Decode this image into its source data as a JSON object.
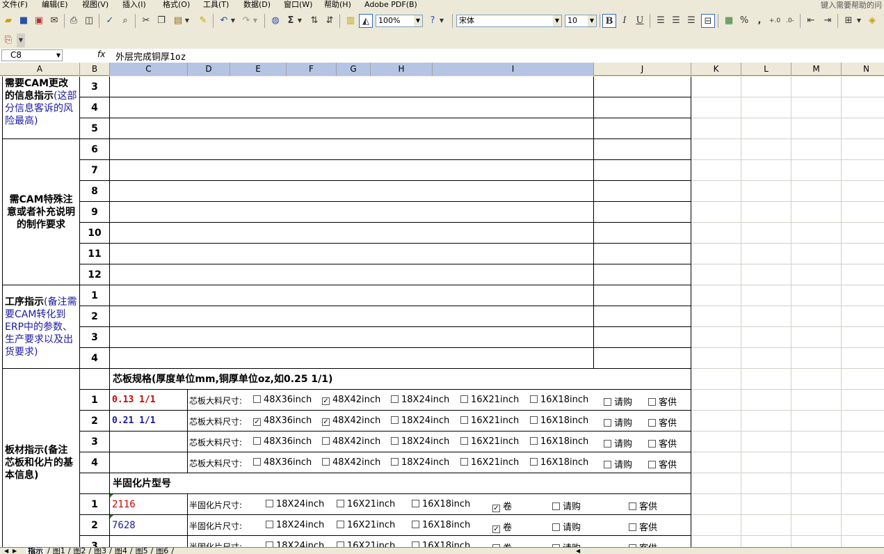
{
  "menu": [
    "文件(F)",
    "编辑(E)",
    "视图(V)",
    "插入(I)",
    "格式(O)",
    "工具(T)",
    "数据(D)",
    "窗口(W)",
    "帮助(H)",
    "Adobe PDF(B)"
  ],
  "help_search": "键入需要帮助的问",
  "toolbar": {
    "zoom": "100%",
    "font_name": "宋体",
    "font_size": "10",
    "sum_symbol": "Σ",
    "bold": "B",
    "italic": "I",
    "underline": "U",
    "percent": "%",
    "comma": ","
  },
  "formula_bar": {
    "name_box": "C8",
    "fx": "fx",
    "formula": "外层完成铜厚1oz"
  },
  "columns": [
    "A",
    "B",
    "C",
    "D",
    "E",
    "F",
    "G",
    "H",
    "I",
    "J",
    "K",
    "L",
    "M",
    "N"
  ],
  "sections": {
    "cam_change": {
      "title": "需要CAM更改的信息指示",
      "note": "(这部分信息客诉的风险最高)",
      "rows": [
        "3",
        "4",
        "5"
      ]
    },
    "cam_special": {
      "title": "需CAM特殊注意或者补充说明的制作要求",
      "rows": [
        "6",
        "7",
        "8",
        "9",
        "10",
        "11",
        "12"
      ]
    },
    "process": {
      "title": "工序指示",
      "note": "(备注需要CAM转化到ERP中的参数、生产要求以及出货要求)",
      "rows": [
        "1",
        "2",
        "3",
        "4"
      ]
    },
    "board": {
      "title": "板材指示",
      "note": "(备注芯板和化片的基本信息)",
      "core_header": "芯板规格(厚度单位mm,铜厚单位oz,如0.25 1/1)",
      "core_label": "芯板大料尺寸:",
      "core_options": [
        "48X36inch",
        "48X42inch",
        "18X24inch",
        "16X21inch",
        "16X18inch",
        "请购",
        "客供"
      ],
      "core_rows": [
        {
          "no": "1",
          "spec": "0.13 1/1",
          "checks": [
            false,
            true,
            false,
            false,
            false,
            false,
            false
          ]
        },
        {
          "no": "2",
          "spec": "0.21 1/1",
          "checks": [
            true,
            true,
            false,
            false,
            false,
            false,
            false
          ]
        },
        {
          "no": "3",
          "spec": "",
          "checks": [
            false,
            false,
            false,
            false,
            false,
            false,
            false
          ]
        },
        {
          "no": "4",
          "spec": "",
          "checks": [
            false,
            false,
            false,
            false,
            false,
            false,
            false
          ]
        }
      ],
      "pp_header": "半固化片型号",
      "pp_label": "半固化片尺寸:",
      "pp_options": [
        "18X24inch",
        "16X21inch",
        "16X18inch",
        "卷",
        "请购",
        "客供"
      ],
      "pp_rows": [
        {
          "no": "1",
          "type": "2116",
          "checks": [
            false,
            false,
            false,
            true,
            false,
            false
          ]
        },
        {
          "no": "2",
          "type": "7628",
          "checks": [
            false,
            false,
            false,
            true,
            false,
            false
          ]
        },
        {
          "no": "3",
          "type": "",
          "checks": [
            false,
            false,
            false,
            false,
            false,
            false
          ]
        }
      ]
    }
  },
  "sheet_tabs": [
    "指示",
    "图1",
    "图2",
    "图3",
    "图4",
    "图5",
    "图6"
  ],
  "colors": {
    "selected_header": "#b6c4e4",
    "blue_text": "#1a1aa6",
    "red_text": "#cc0000"
  }
}
